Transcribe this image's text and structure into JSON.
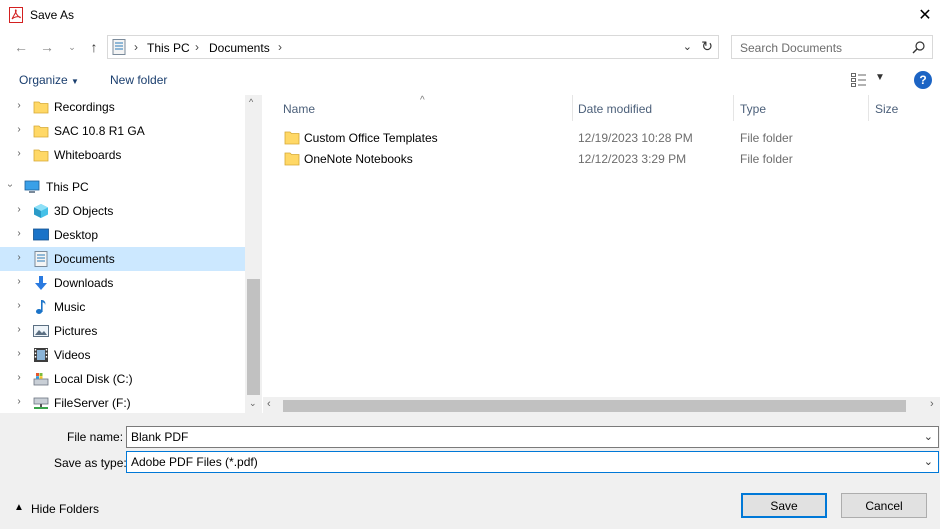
{
  "window": {
    "title": "Save As"
  },
  "nav": {
    "breadcrumbs": [
      "This PC",
      "Documents"
    ],
    "search_placeholder": "Search Documents"
  },
  "toolbar": {
    "organize": "Organize",
    "new_folder": "New folder"
  },
  "tree": {
    "items": [
      {
        "label": "Recordings",
        "icon": "folder-icon"
      },
      {
        "label": "SAC 10.8 R1 GA",
        "icon": "folder-icon"
      },
      {
        "label": "Whiteboards",
        "icon": "folder-icon"
      },
      {
        "label": "This PC",
        "icon": "computer-icon"
      },
      {
        "label": "3D Objects",
        "icon": "cube-icon"
      },
      {
        "label": "Desktop",
        "icon": "desktop-icon"
      },
      {
        "label": "Documents",
        "icon": "document-icon",
        "selected": true
      },
      {
        "label": "Downloads",
        "icon": "download-icon"
      },
      {
        "label": "Music",
        "icon": "music-icon"
      },
      {
        "label": "Pictures",
        "icon": "picture-icon"
      },
      {
        "label": "Videos",
        "icon": "video-icon"
      },
      {
        "label": "Local Disk (C:)",
        "icon": "drive-icon"
      },
      {
        "label": "FileServer (F:)",
        "icon": "network-drive-icon"
      }
    ]
  },
  "columns": {
    "name": "Name",
    "date": "Date modified",
    "type": "Type",
    "size": "Size"
  },
  "files": [
    {
      "name": "Custom Office Templates",
      "date": "12/19/2023 10:28 PM",
      "type": "File folder"
    },
    {
      "name": "OneNote Notebooks",
      "date": "12/12/2023 3:29 PM",
      "type": "File folder"
    }
  ],
  "form": {
    "filename_label": "File name:",
    "filename_value": "Blank PDF",
    "savetype_label": "Save as type:",
    "savetype_value": "Adobe PDF Files (*.pdf)"
  },
  "footer": {
    "hide_folders": "Hide Folders",
    "save": "Save",
    "cancel": "Cancel"
  },
  "colors": {
    "accent": "#0078d7",
    "selection": "#cce8ff",
    "folder": "#ffd866"
  }
}
